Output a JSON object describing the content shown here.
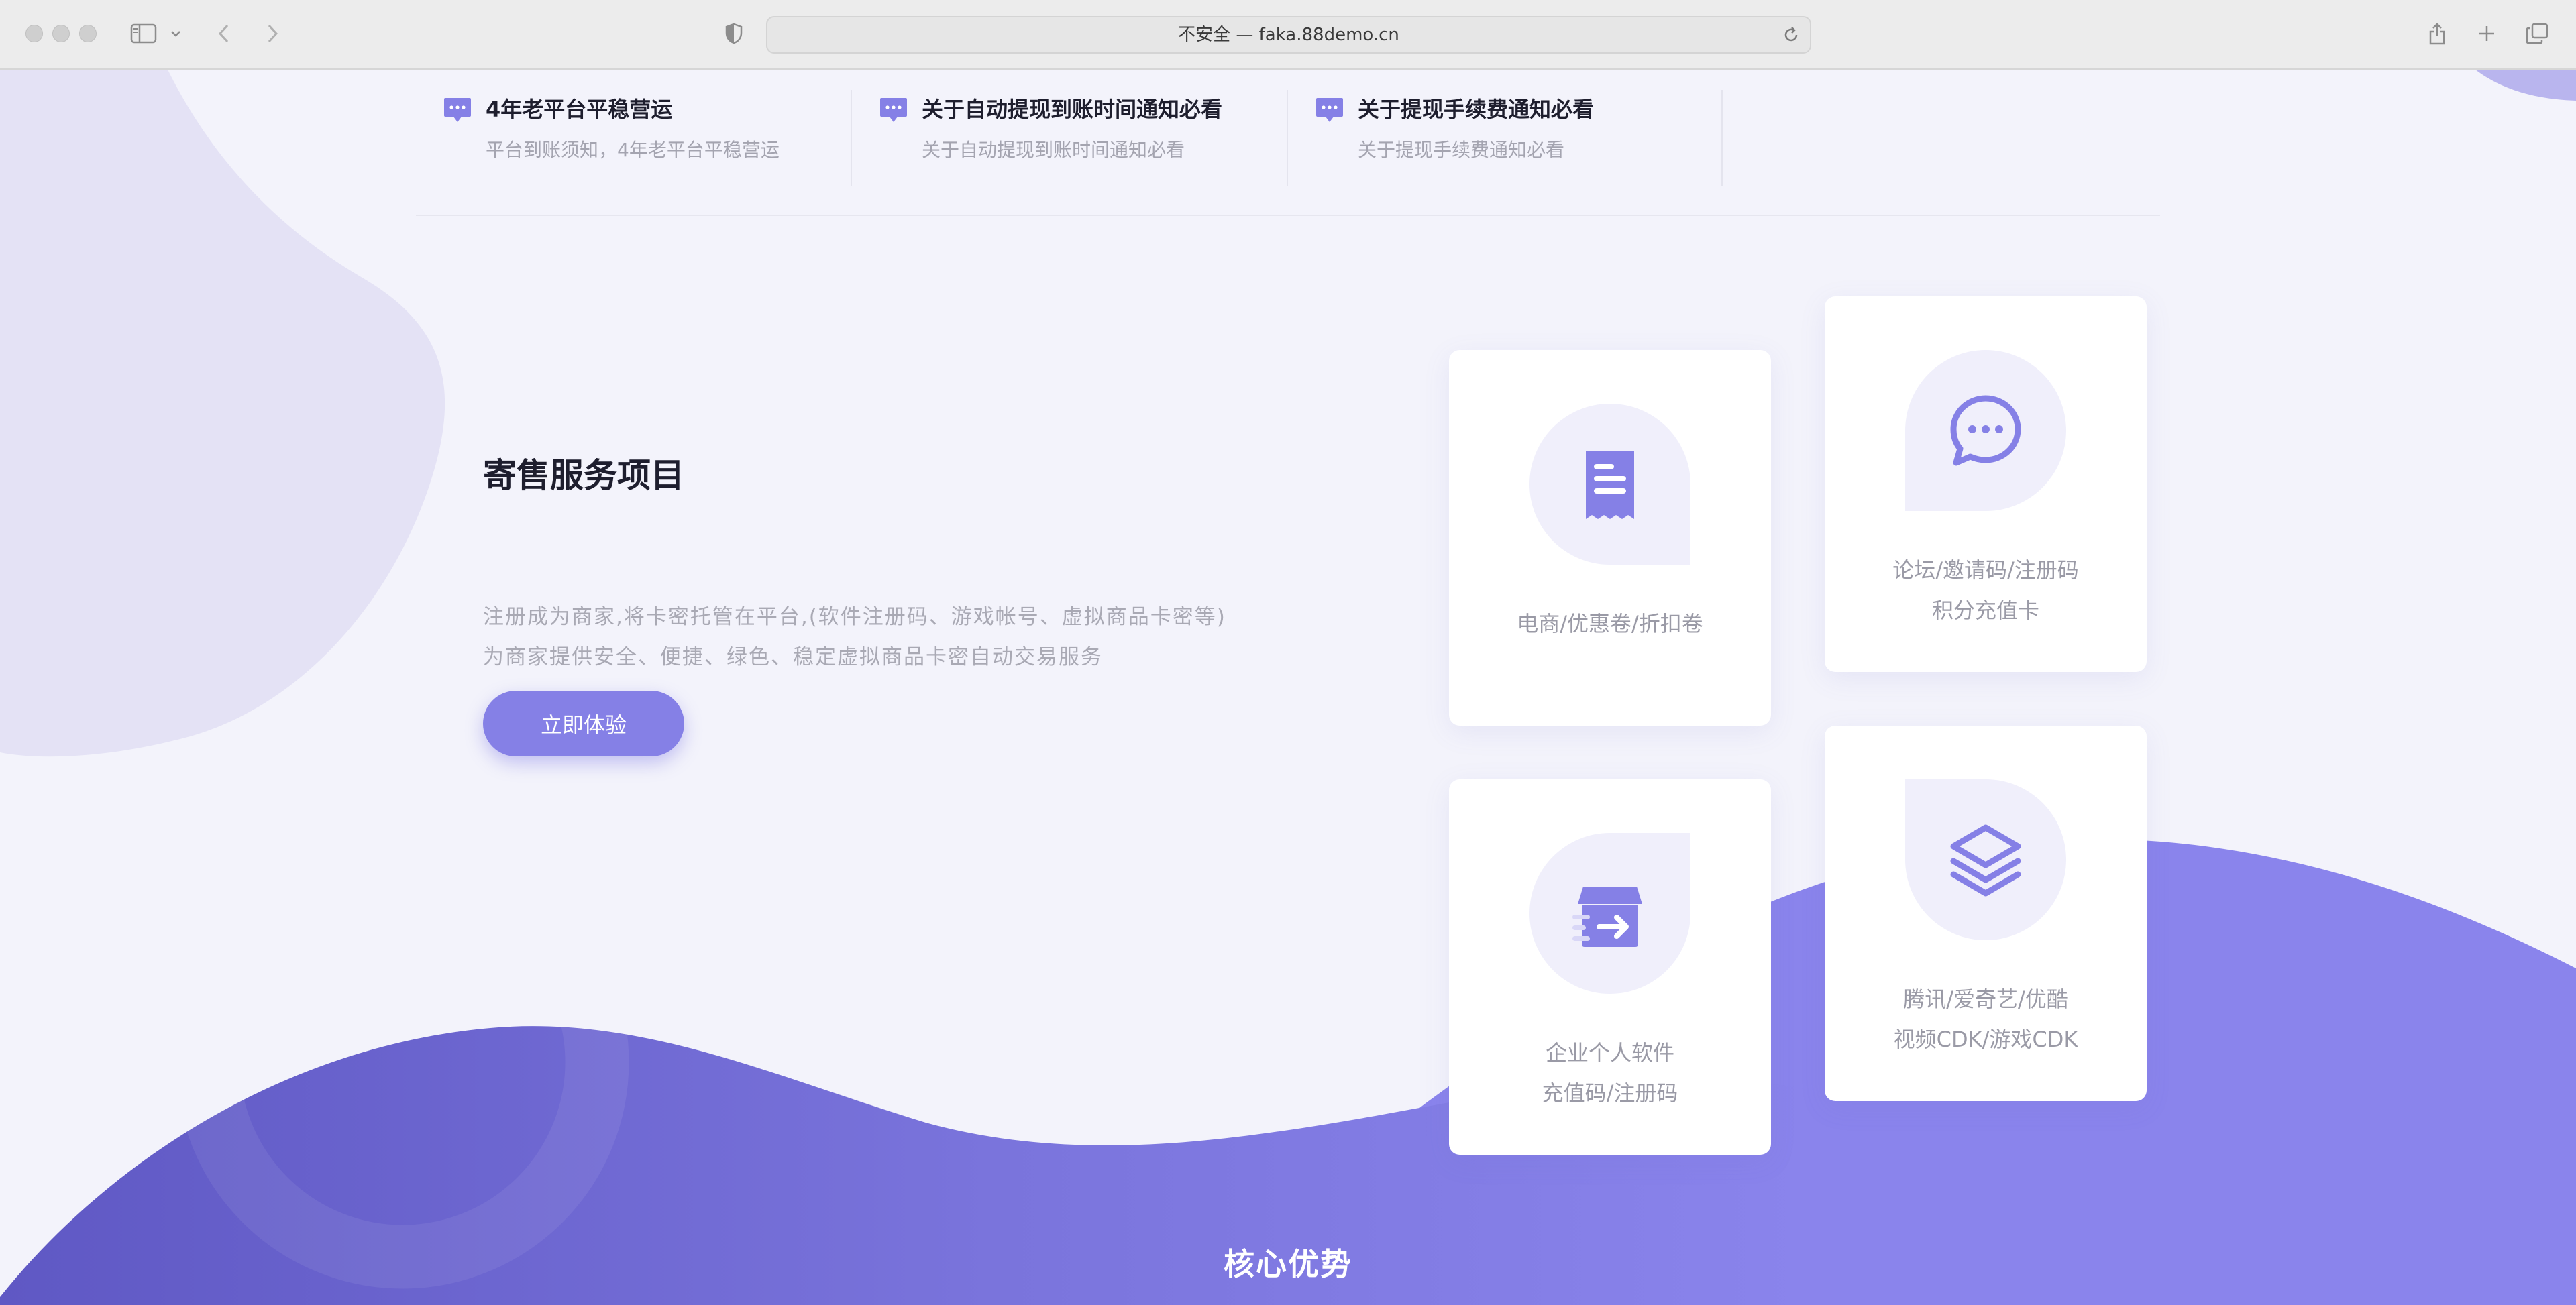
{
  "browser": {
    "url": "不安全 — faka.88demo.cn"
  },
  "notices": [
    {
      "title": "4年老平台平稳营运",
      "subtitle": "平台到账须知，4年老平台平稳营运"
    },
    {
      "title": "关于自动提现到账时间通知必看",
      "subtitle": "关于自动提现到账时间通知必看"
    },
    {
      "title": "关于提现手续费通知必看",
      "subtitle": "关于提现手续费通知必看"
    }
  ],
  "intro": {
    "title": "寄售服务项目",
    "description_line1": "注册成为商家,将卡密托管在平台,(软件注册码、游戏帐号、虚拟商品卡密等)",
    "description_line2": "为商家提供安全、便捷、绿色、稳定虚拟商品卡密自动交易服务",
    "cta_label": "立即体验"
  },
  "cards": [
    {
      "icon": "receipt-icon",
      "line1": "电商/优惠卷/折扣卷",
      "line2": ""
    },
    {
      "icon": "chat-bubble-icon",
      "line1": "论坛/邀请码/注册码",
      "line2": "积分充值卡"
    },
    {
      "icon": "box-arrow-icon",
      "line1": "企业个人软件",
      "line2": "充值码/注册码"
    },
    {
      "icon": "layers-icon",
      "line1": "腾讯/爱奇艺/优酷",
      "line2": "视频CDK/游戏CDK"
    }
  ],
  "core_section": {
    "title": "核心优势"
  },
  "colors": {
    "accent": "#8580e6",
    "wave_dark": "#5f58c4",
    "wave_light": "#8a84ec",
    "blob": "#e4e2f5"
  }
}
